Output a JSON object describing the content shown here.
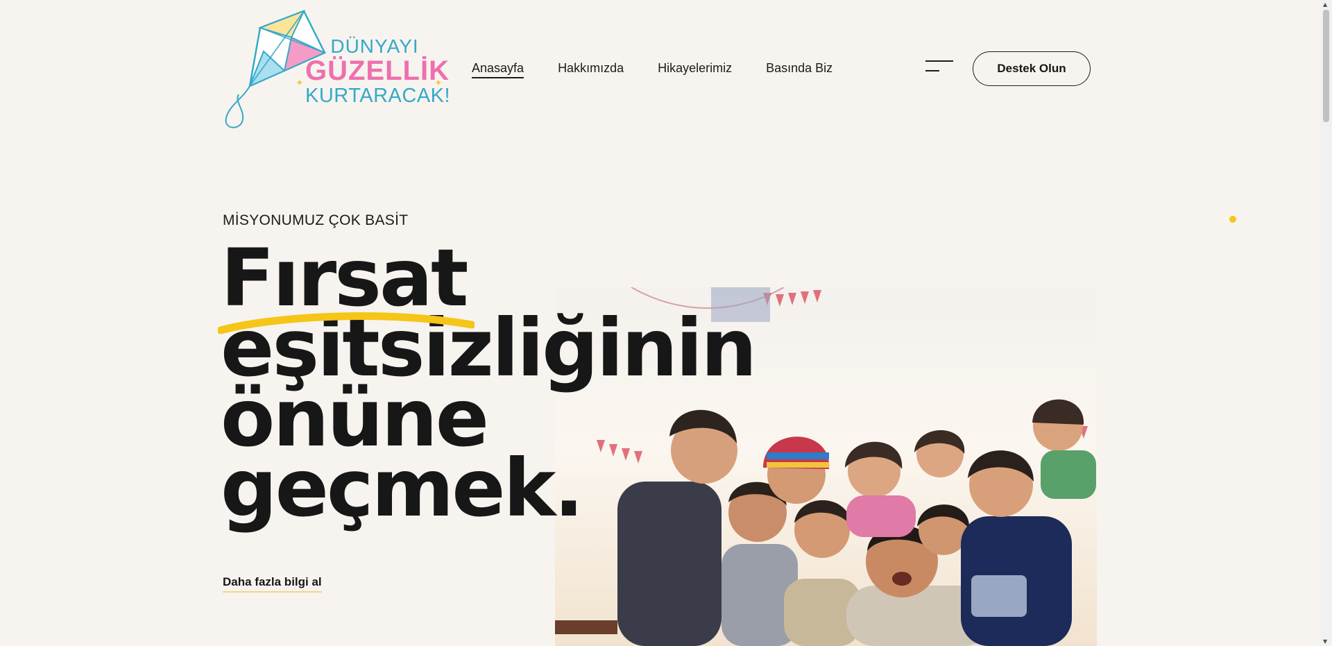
{
  "logo": {
    "line1": "DÜNYAYI",
    "line2": "GÜZELLİK",
    "line3": "KURTARACAK!"
  },
  "nav": {
    "items": [
      {
        "label": "Anasayfa",
        "active": true
      },
      {
        "label": "Hakkımızda",
        "active": false
      },
      {
        "label": "Hikayelerimiz",
        "active": false
      },
      {
        "label": "Basında Biz",
        "active": false
      }
    ]
  },
  "header": {
    "cta_label": "Destek Olun",
    "menu_icon": "menu-icon"
  },
  "hero": {
    "eyebrow": "MİSYONUMUZ ÇOK BASİT",
    "headline": [
      "Fırsat",
      "eşitsizliğinin",
      "önüne",
      "geçmek."
    ],
    "more_link": "Daha fazla bilgi al",
    "photo_alt": "photo-children-celebrating"
  },
  "colors": {
    "background": "#f7f4ef",
    "text": "#171717",
    "accent_yellow": "#f5c518",
    "logo_blue": "#34a9c9",
    "logo_pink": "#ef6fae"
  }
}
